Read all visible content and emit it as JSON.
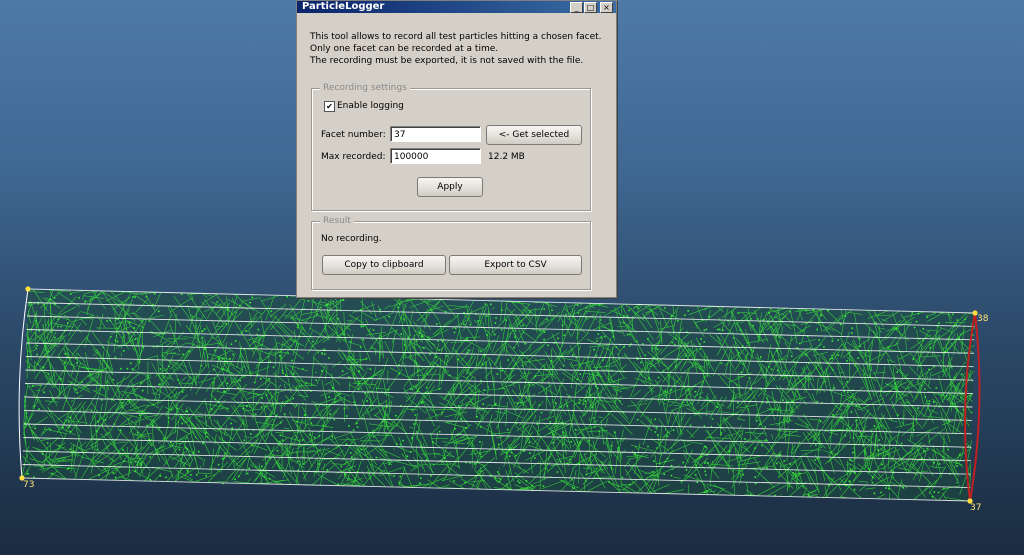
{
  "window": {
    "title": "ParticleLogger",
    "description": [
      "This tool allows to record all test particles hitting a chosen facet.",
      "Only one facet can be recorded at a time.",
      "The recording must be exported, it is not saved with the file."
    ]
  },
  "recording": {
    "legend": "Recording settings",
    "enable_label": "Enable logging",
    "enable_checked": true,
    "facet_label": "Facet number:",
    "facet_value": "37",
    "get_selected_label": "<- Get selected",
    "max_label": "Max recorded:",
    "max_value": "100000",
    "size_text": "12.2 MB",
    "apply_label": "Apply"
  },
  "result": {
    "legend": "Result",
    "status": "No recording.",
    "copy_label": "Copy to clipboard",
    "export_label": "Export to CSV"
  },
  "viewer": {
    "vertex_labels": {
      "top_right": "38",
      "bottom_left": "73",
      "bottom_right": "37"
    },
    "colors": {
      "mesh": "#38e838",
      "edges": "#ffffff",
      "selected_facet": "#c02020",
      "vertex": "#ffe040"
    }
  }
}
